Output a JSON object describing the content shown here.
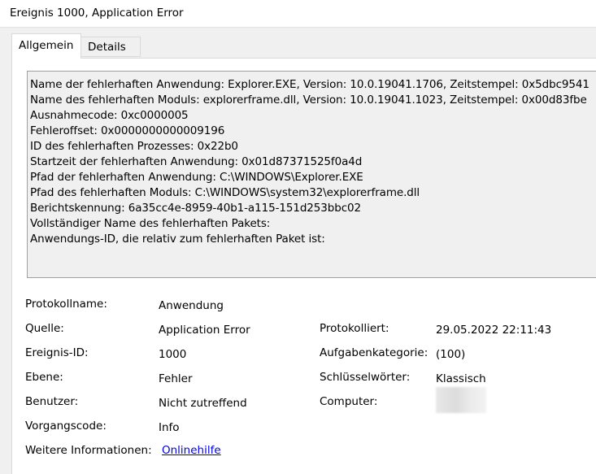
{
  "window": {
    "title": "Ereignis 1000, Application Error"
  },
  "tabs": [
    {
      "label": "Allgemein",
      "active": true
    },
    {
      "label": "Details",
      "active": false
    }
  ],
  "description": {
    "lines": [
      "Name der fehlerhaften Anwendung: Explorer.EXE, Version: 10.0.19041.1706, Zeitstempel: 0x5dbc9541",
      "Name des fehlerhaften Moduls: explorerframe.dll, Version: 10.0.19041.1023, Zeitstempel: 0x00d83fbe",
      "Ausnahmecode: 0xc0000005",
      "Fehleroffset: 0x0000000000009196",
      "ID des fehlerhaften Prozesses: 0x22b0",
      "Startzeit der fehlerhaften Anwendung: 0x01d87371525f0a4d",
      "Pfad der fehlerhaften Anwendung: C:\\WINDOWS\\Explorer.EXE",
      "Pfad des fehlerhaften Moduls: C:\\WINDOWS\\system32\\explorerframe.dll",
      "Berichtskennung: 6a35cc4e-8959-40b1-a115-151d253bbc02",
      "Vollständiger Name des fehlerhaften Pakets:",
      "Anwendungs-ID, die relativ zum fehlerhaften Paket ist:"
    ]
  },
  "properties": {
    "protokollname": {
      "label": "Protokollname:",
      "value": "Anwendung"
    },
    "quelle": {
      "label": "Quelle:",
      "value": "Application Error"
    },
    "ereignis_id": {
      "label": "Ereignis-ID:",
      "value": "1000"
    },
    "ebene": {
      "label": "Ebene:",
      "value": "Fehler"
    },
    "benutzer": {
      "label": "Benutzer:",
      "value": "Nicht zutreffend"
    },
    "vorgangscode": {
      "label": "Vorgangscode:",
      "value": "Info"
    },
    "weitere_info": {
      "label": "Weitere Informationen:",
      "value": "Onlinehilfe"
    },
    "protokolliert": {
      "label": "Protokolliert:",
      "value": "29.05.2022 22:11:43"
    },
    "aufgabenkategorie": {
      "label": "Aufgabenkategorie:",
      "value": "(100)"
    },
    "schluesselwoerter": {
      "label": "Schlüsselwörter:",
      "value": "Klassisch"
    },
    "computer": {
      "label": "Computer:",
      "value": ""
    }
  }
}
